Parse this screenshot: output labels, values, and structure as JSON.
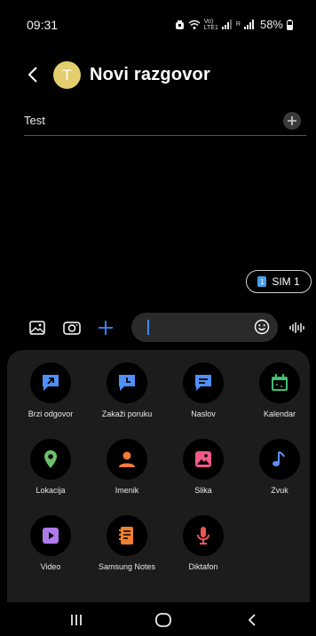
{
  "status_bar": {
    "time": "09:31",
    "voice_top": "Vo)",
    "voice_bottom": "LTE1",
    "sim2_label": "R",
    "battery": "58%"
  },
  "header": {
    "avatar_letter": "T",
    "title": "Novi razgovor"
  },
  "recipient": {
    "value": "Test"
  },
  "sim_selector": {
    "badge": "1",
    "label": "SIM 1"
  },
  "composer": {
    "input_value": ""
  },
  "attachments": [
    {
      "label": "Brzi odgovor",
      "icon": "quick-reply-icon",
      "color": "#4f8ff7"
    },
    {
      "label": "Zakaži poruku",
      "icon": "schedule-message-icon",
      "color": "#4f8ff7"
    },
    {
      "label": "Naslov",
      "icon": "subject-icon",
      "color": "#4f8ff7"
    },
    {
      "label": "Kalendar",
      "icon": "calendar-icon",
      "color": "#3fbf73"
    },
    {
      "label": "Lokacija",
      "icon": "location-icon",
      "color": "#6cc06a"
    },
    {
      "label": "Imenik",
      "icon": "contacts-icon",
      "color": "#f07c3a"
    },
    {
      "label": "Slika",
      "icon": "image-icon",
      "color": "#ef5a8a"
    },
    {
      "label": "Zvuk",
      "icon": "music-icon",
      "color": "#5e8ff5"
    },
    {
      "label": "Video",
      "icon": "video-icon",
      "color": "#b07ae8"
    },
    {
      "label": "Samsung Notes",
      "icon": "notes-icon",
      "color": "#f07f2f"
    },
    {
      "label": "Diktafon",
      "icon": "microphone-icon",
      "color": "#ef5555"
    }
  ],
  "colors": {
    "accent": "#3f8cff",
    "background": "#000000",
    "drawer": "#1c1c1c"
  }
}
